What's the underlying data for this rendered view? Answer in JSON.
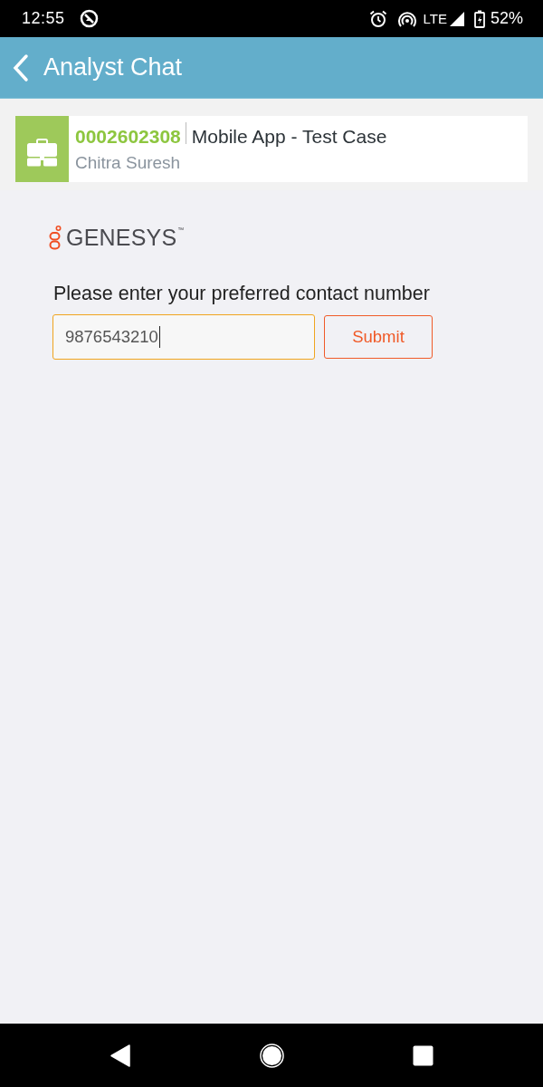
{
  "status_bar": {
    "time": "12:55",
    "network": "LTE",
    "battery": "52%"
  },
  "app_bar": {
    "title": "Analyst Chat"
  },
  "case_card": {
    "case_number": "0002602308",
    "subject": "Mobile App - Test Case",
    "contact": "Chitra Suresh"
  },
  "logo": {
    "wordmark": "GENESYS",
    "trademark": "™"
  },
  "form": {
    "label": "Please enter your preferred contact number",
    "field": {
      "value": "9876543210",
      "focused": true
    },
    "submit": "Submit"
  },
  "nav_bar": {
    "buttons": [
      {
        "kind": "back"
      },
      {
        "kind": "home"
      },
      {
        "kind": "recents"
      }
    ]
  }
}
